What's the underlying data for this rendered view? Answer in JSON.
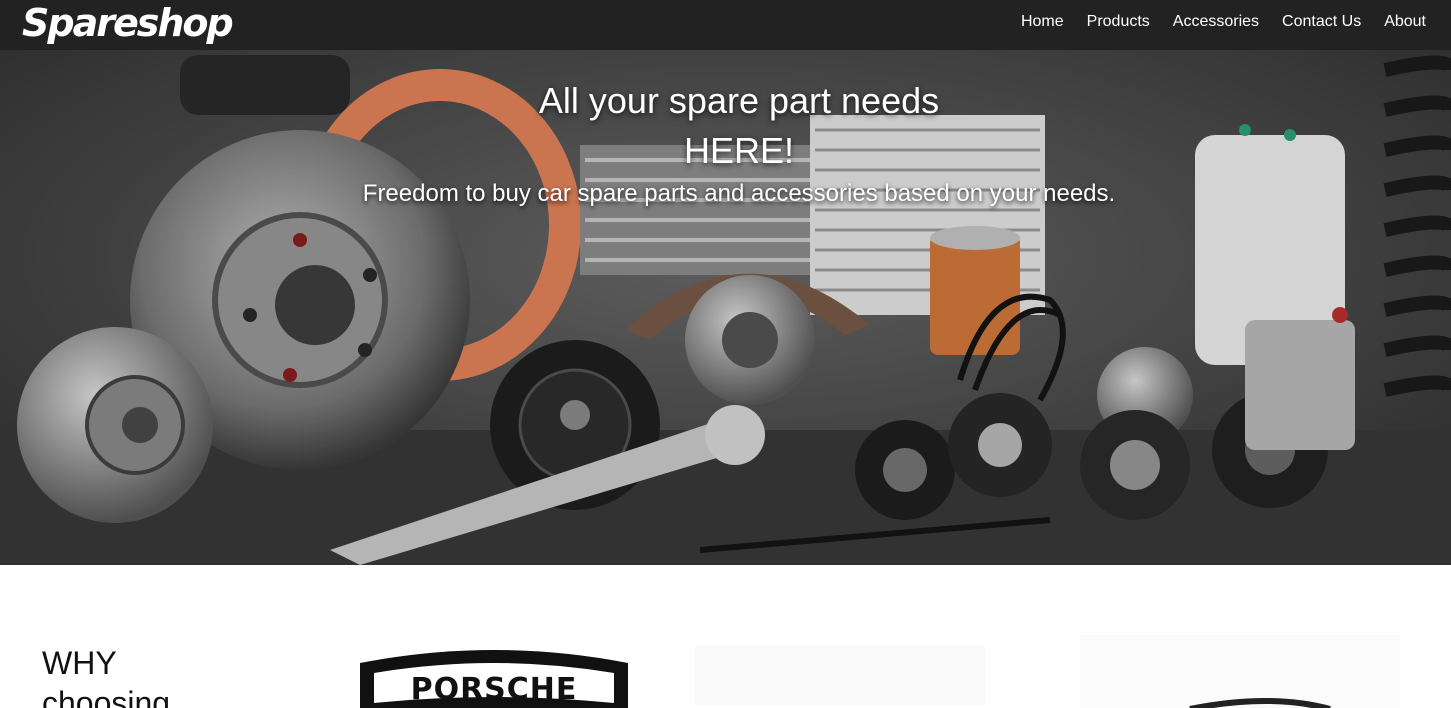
{
  "header": {
    "brand": "Spareshop",
    "nav": [
      "Home",
      "Products",
      "Accessories",
      "Contact Us",
      "About"
    ]
  },
  "hero": {
    "title_line1": "All your spare part needs",
    "title_line2": "HERE!",
    "subtitle": "Freedom to buy car spare parts and accessories based on your needs."
  },
  "why": {
    "heading_line1": "WHY",
    "heading_line2": "choosing",
    "logos": [
      "PORSCHE"
    ]
  },
  "colors": {
    "navbar_bg": "#222222",
    "hero_overlay": "#4a4a4a",
    "accent_orange": "#e8845c"
  }
}
